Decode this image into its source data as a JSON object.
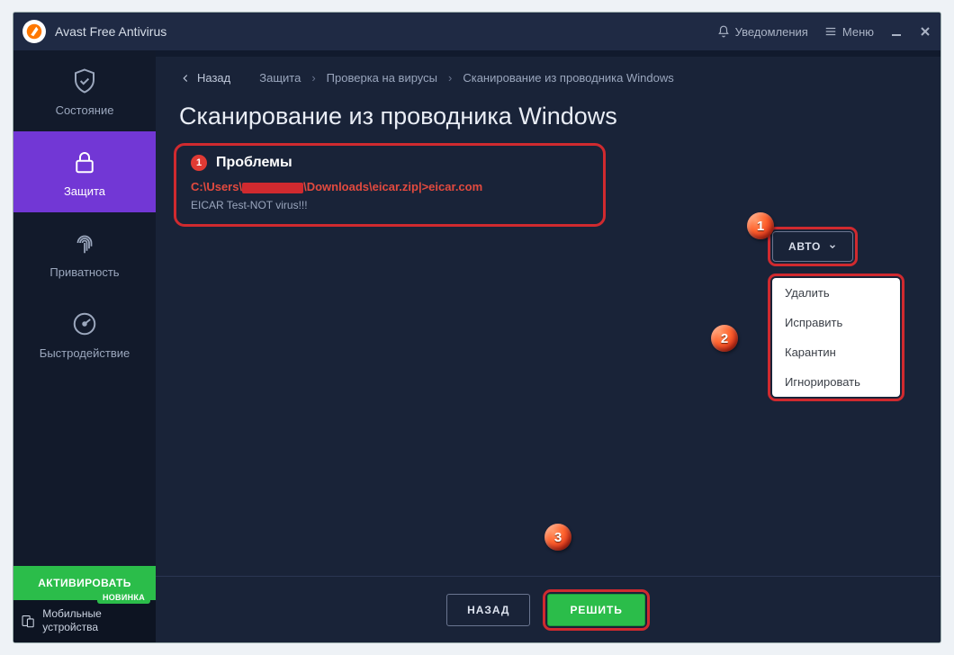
{
  "titlebar": {
    "app_name": "Avast Free Antivirus",
    "notifications": "Уведомления",
    "menu": "Меню"
  },
  "sidebar": {
    "items": [
      {
        "label": "Состояние"
      },
      {
        "label": "Защита"
      },
      {
        "label": "Приватность"
      },
      {
        "label": "Быстродействие"
      }
    ],
    "activate": "АКТИВИРОВАТЬ",
    "novinka": "НОВИНКА",
    "mobile": "Мобильные устройства"
  },
  "breadcrumb": {
    "back": "Назад",
    "c1": "Защита",
    "c2": "Проверка на вирусы",
    "c3": "Сканирование из проводника Windows"
  },
  "page": {
    "title": "Сканирование из проводника Windows"
  },
  "problem": {
    "count": "1",
    "heading": "Проблемы",
    "path_prefix": "C:\\Users\\",
    "path_suffix": "\\Downloads\\eicar.zip|>eicar.com",
    "desc": "EICAR Test-NOT virus!!!"
  },
  "action": {
    "auto": "АВТО",
    "menu": [
      "Удалить",
      "Исправить",
      "Карантин",
      "Игнорировать"
    ]
  },
  "callouts": {
    "one": "1",
    "two": "2",
    "three": "3"
  },
  "bottom": {
    "back": "НАЗАД",
    "solve": "РЕШИТЬ"
  }
}
